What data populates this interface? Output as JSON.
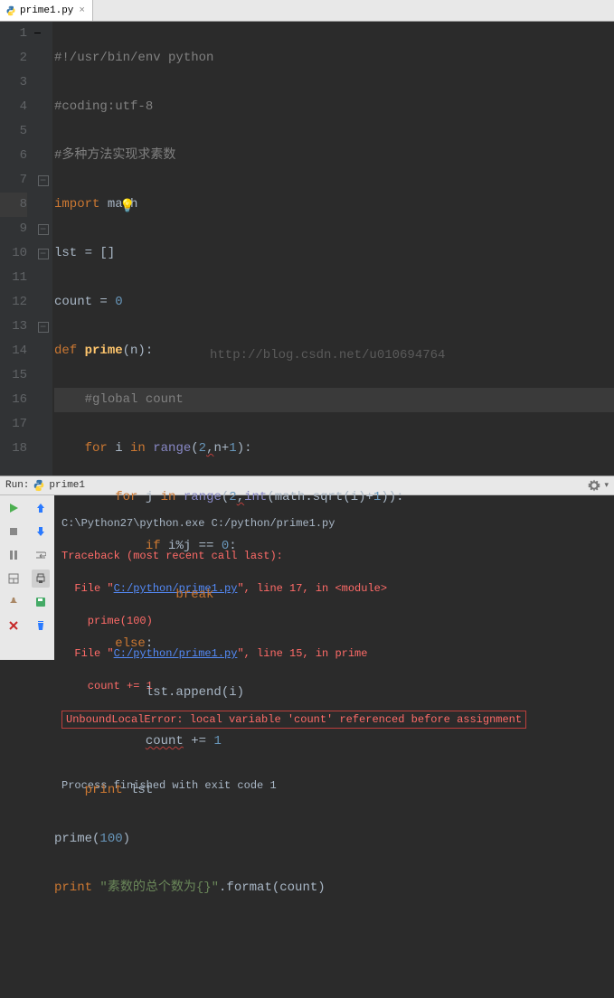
{
  "tab": {
    "name": "prime1.py"
  },
  "code": {
    "lines": [
      {
        "n": 1,
        "raw": "#!/usr/bin/env python"
      },
      {
        "n": 2,
        "raw": "#coding:utf-8"
      },
      {
        "n": 3,
        "raw": "#多种方法实现求素数"
      },
      {
        "n": 4,
        "raw": "import math"
      },
      {
        "n": 5,
        "raw": "lst = []"
      },
      {
        "n": 6,
        "raw": "count = 0"
      },
      {
        "n": 7,
        "raw": "def prime(n):"
      },
      {
        "n": 8,
        "raw": "    #global count"
      },
      {
        "n": 9,
        "raw": "    for i in range(2,n+1):"
      },
      {
        "n": 10,
        "raw": "        for j in range(2,int(math.sqrt(i)+1)):"
      },
      {
        "n": 11,
        "raw": "            if i%j == 0:"
      },
      {
        "n": 12,
        "raw": "                break"
      },
      {
        "n": 13,
        "raw": "        else:"
      },
      {
        "n": 14,
        "raw": "            lst.append(i)"
      },
      {
        "n": 15,
        "raw": "            count += 1"
      },
      {
        "n": 16,
        "raw": "    print lst"
      },
      {
        "n": 17,
        "raw": "prime(100)"
      },
      {
        "n": 18,
        "raw": "print \"素数的总个数为{}\".format(count)"
      }
    ],
    "watermark": "http://blog.csdn.net/u010694764"
  },
  "run": {
    "label": "Run:",
    "config": "prime1",
    "output": {
      "cmd": "C:\\Python27\\python.exe C:/python/prime1.py",
      "trace_header": "Traceback (most recent call last):",
      "frame1_pre": "  File \"",
      "frame1_file": "C:/python/prime1.py",
      "frame1_post": "\", line 17, in <module>",
      "frame1_code": "    prime(100)",
      "frame2_pre": "  File \"",
      "frame2_file": "C:/python/prime1.py",
      "frame2_post": "\", line 15, in prime",
      "frame2_code": "    count += 1",
      "error": "UnboundLocalError: local variable 'count' referenced before assignment",
      "exit": "Process finished with exit code 1"
    }
  }
}
